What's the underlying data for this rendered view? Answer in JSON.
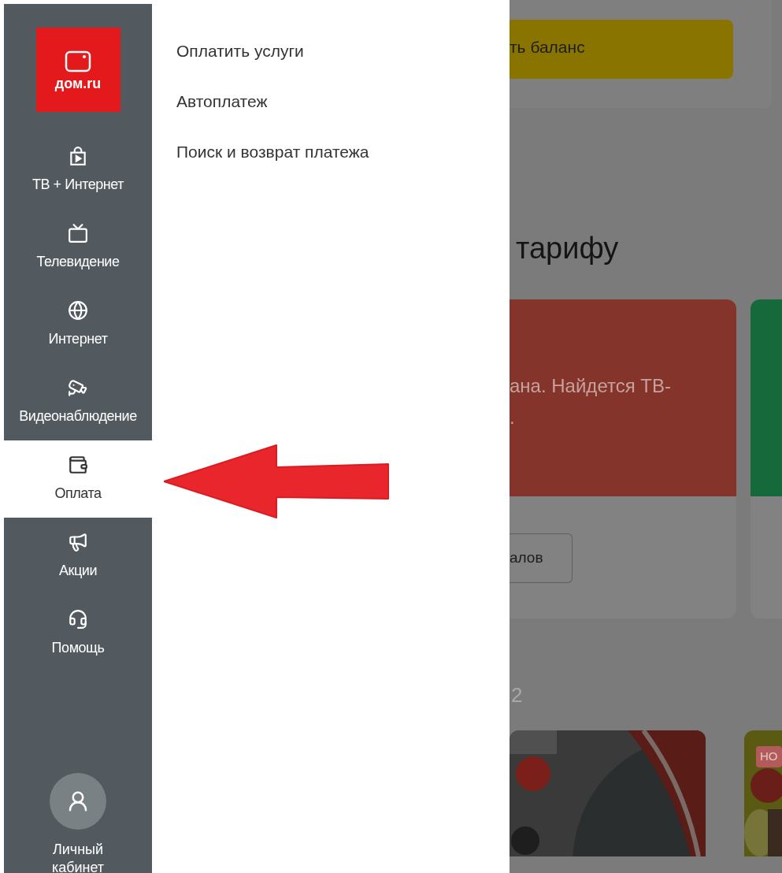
{
  "logo": {
    "text": "дом.ru"
  },
  "sidebar": {
    "items": [
      {
        "label": "ТВ + Интернет",
        "selected": false
      },
      {
        "label": "Телевидение",
        "selected": false
      },
      {
        "label": "Интернет",
        "selected": false
      },
      {
        "label": "Видеонаблюдение",
        "selected": false
      },
      {
        "label": "Оплата",
        "selected": true
      },
      {
        "label": "Акции",
        "selected": false
      },
      {
        "label": "Помощь",
        "selected": false
      }
    ],
    "account": {
      "label": "Личный кабинет"
    }
  },
  "submenu": {
    "items": [
      "Оплатить услуги",
      "Автоплатеж",
      "Поиск и возврат платежа"
    ]
  },
  "background": {
    "balance_button": "ть баланс",
    "heading": "тарифу",
    "promo_text": "ана. Найдется ТВ-",
    "promo_text_2": ".",
    "channels_button": "алов",
    "counter": "2",
    "badge": "НО"
  }
}
